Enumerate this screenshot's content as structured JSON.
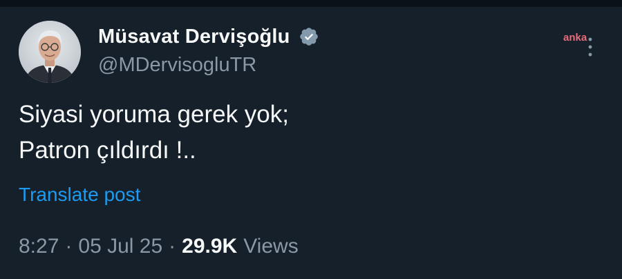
{
  "post": {
    "author": {
      "display_name": "Müsavat Dervişoğlu",
      "handle": "@MDervisogluTR",
      "verified_icon": "verified-badge-icon",
      "verified_color": "#829aab"
    },
    "watermark": "anka",
    "text_lines": [
      "Siyasi yoruma gerek yok;",
      "Patron çıldırdı !.."
    ],
    "translate_label": "Translate post",
    "time": "8:27",
    "date": "05 Jul 25",
    "separator": "·",
    "views_count": "29.9K",
    "views_label": "Views"
  },
  "colors": {
    "background": "#15202b",
    "primary_text": "#f7f9f9",
    "secondary_text": "#8b98a5",
    "link": "#1d9bf0",
    "watermark": "#e96a78"
  }
}
